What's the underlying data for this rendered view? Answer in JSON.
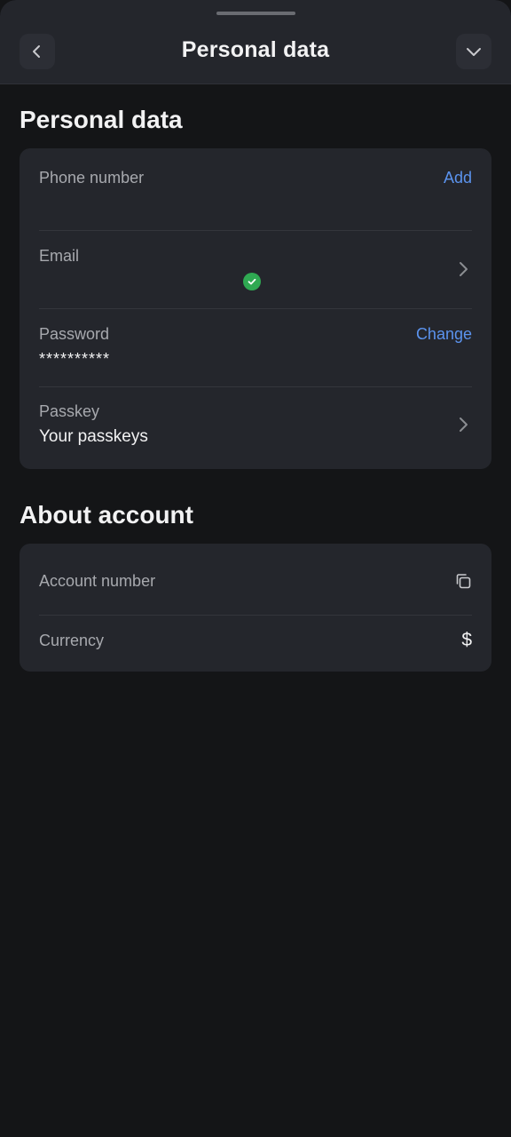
{
  "header": {
    "title": "Personal data",
    "back_icon": "chevron-left-icon",
    "collapse_icon": "chevron-down-icon"
  },
  "personal_section": {
    "title": "Personal data",
    "rows": {
      "phone": {
        "label": "Phone number",
        "action": "Add"
      },
      "email": {
        "label": "Email",
        "status_icon": "check-circle-icon",
        "arrow_icon": "chevron-right-icon"
      },
      "password": {
        "label": "Password",
        "value": "**********",
        "action": "Change"
      },
      "passkey": {
        "label": "Passkey",
        "value": "Your passkeys",
        "arrow_icon": "chevron-right-icon"
      }
    }
  },
  "account_section": {
    "title": "About account",
    "rows": {
      "account_number": {
        "label": "Account number",
        "icon": "copy-icon"
      },
      "currency": {
        "label": "Currency",
        "value": "$"
      }
    }
  },
  "colors": {
    "background": "#141517",
    "card": "#24262c",
    "accent": "#5b93ee",
    "verified": "#2fa952"
  }
}
